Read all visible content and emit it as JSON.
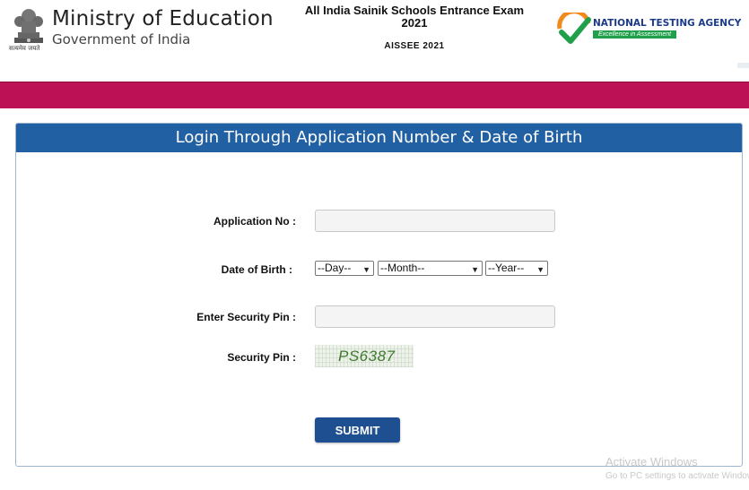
{
  "header": {
    "ministry": "Ministry of Education",
    "government": "Government of India",
    "emblem_caption": "सत्यमेव जयते",
    "exam_title_line1": "All India Sainik Schools Entrance Exam",
    "exam_title_line2": "2021",
    "exam_code": "AISSEE 2021",
    "agency_name": "NATIONAL TESTING AGENCY",
    "agency_tagline": "Excellence in Assessment"
  },
  "colors": {
    "band": "#bd1155",
    "panel_header": "#2260a4",
    "submit": "#1d4f91",
    "nta_green": "#21a04b",
    "nta_orange": "#f08a1c"
  },
  "form": {
    "title": "Login Through Application Number & Date of Birth",
    "application_label": "Application No :",
    "application_value": "",
    "dob_label": "Date of Birth :",
    "day_select": "--Day--",
    "month_select": "--Month--",
    "year_select": "--Year--",
    "security_input_label": "Enter Security Pin :",
    "security_input_value": "",
    "security_pin_label": "Security Pin :",
    "captcha_text": "PS6387",
    "submit_label": "SUBMIT"
  },
  "watermark": {
    "line1": "Activate Windows",
    "line2": "Go to PC settings to activate Windows."
  },
  "icons": {
    "emblem": "national-emblem-icon",
    "nta": "nta-check-logo-icon",
    "select_arrow": "chevron-down-icon"
  }
}
